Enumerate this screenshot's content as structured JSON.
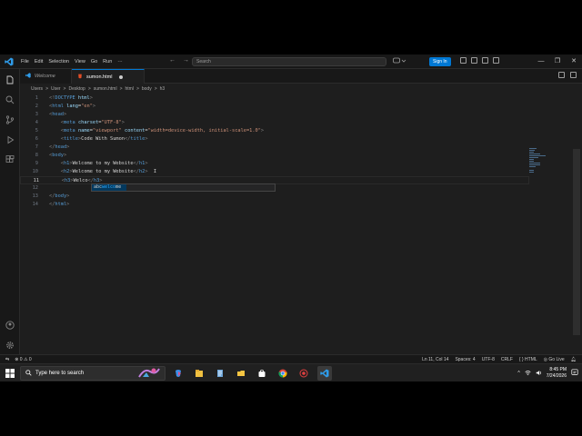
{
  "titlebar": {
    "menu": [
      "File",
      "Edit",
      "Selection",
      "View",
      "Go",
      "Run",
      "···"
    ],
    "nav_back": "←",
    "nav_forward": "→",
    "search_placeholder": "Search",
    "sign_in_label": "Sign In",
    "window_controls": [
      "—",
      "❐",
      "✕"
    ]
  },
  "tabs": [
    {
      "label": "Welcome",
      "icon": "vscode-icon"
    },
    {
      "label": "sumon.html",
      "icon": "html-file-icon",
      "modified": true
    }
  ],
  "breadcrumb": [
    "Users",
    ">",
    "User",
    ">",
    "Desktop",
    ">",
    "sumon.html",
    ">",
    "html",
    ">",
    "body",
    ">",
    "h3"
  ],
  "editor": {
    "line_numbers": [
      "1",
      "2",
      "3",
      "4",
      "5",
      "6",
      "7",
      "8",
      "9",
      "10",
      "11",
      "12",
      "13",
      "14"
    ],
    "current_line": 11,
    "suggestion": {
      "icon": "abc",
      "match": "welco",
      "rest": "me",
      "full": "welcome"
    }
  },
  "statusbar": {
    "left": [
      "⊗ 0 ⚠ 0"
    ],
    "right": [
      "Ln 11, Col 14",
      "Spaces: 4",
      "UTF-8",
      "CRLF",
      "{ } HTML",
      "◎ Go Live"
    ]
  },
  "taskbar": {
    "search_placeholder": "Type here to search",
    "time": "8:45 PM",
    "date": "7/24/2026"
  },
  "colors": {
    "accent": "#0078d4",
    "tag": "#569cd6",
    "attr": "#9cdcfe",
    "string": "#ce9178",
    "text": "#d4d4d4"
  }
}
